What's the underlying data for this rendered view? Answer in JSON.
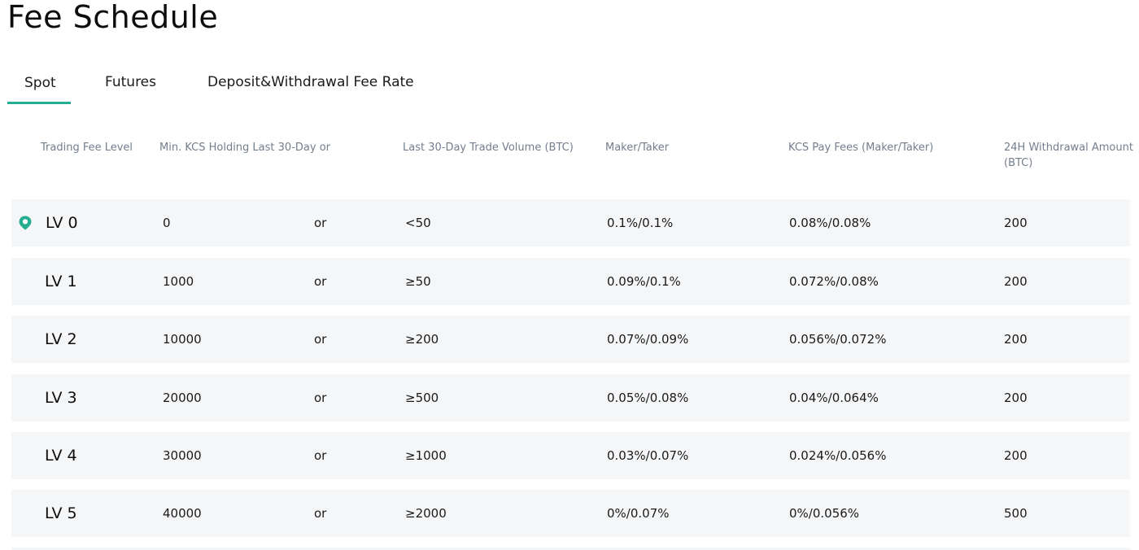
{
  "page": {
    "title": "Fee Schedule"
  },
  "tabs": [
    {
      "label": "Spot",
      "active": true
    },
    {
      "label": "Futures",
      "active": false
    },
    {
      "label": "Deposit&Withdrawal Fee Rate",
      "active": false
    }
  ],
  "table": {
    "headers": {
      "level": "Trading Fee Level",
      "kcs_holding": "Min. KCS Holding Last 30-Day",
      "or": "or",
      "volume": "Last 30-Day Trade Volume (BTC)",
      "maker_taker": "Maker/Taker",
      "kcs_pay": "KCS Pay Fees (Maker/Taker)",
      "withdrawal_line1": "24H Withdrawal Amount",
      "withdrawal_line2": "(BTC)"
    },
    "rows": [
      {
        "level": "LV 0",
        "kcs": "0",
        "or": "or",
        "volume": "<50",
        "maker_taker": "0.1%/0.1%",
        "kcs_pay": "0.08%/0.08%",
        "withdrawal": "200",
        "current": true
      },
      {
        "level": "LV 1",
        "kcs": "1000",
        "or": "or",
        "volume": "≥50",
        "maker_taker": "0.09%/0.1%",
        "kcs_pay": "0.072%/0.08%",
        "withdrawal": "200",
        "current": false
      },
      {
        "level": "LV 2",
        "kcs": "10000",
        "or": "or",
        "volume": "≥200",
        "maker_taker": "0.07%/0.09%",
        "kcs_pay": "0.056%/0.072%",
        "withdrawal": "200",
        "current": false
      },
      {
        "level": "LV 3",
        "kcs": "20000",
        "or": "or",
        "volume": "≥500",
        "maker_taker": "0.05%/0.08%",
        "kcs_pay": "0.04%/0.064%",
        "withdrawal": "200",
        "current": false
      },
      {
        "level": "LV 4",
        "kcs": "30000",
        "or": "or",
        "volume": "≥1000",
        "maker_taker": "0.03%/0.07%",
        "kcs_pay": "0.024%/0.056%",
        "withdrawal": "200",
        "current": false
      },
      {
        "level": "LV 5",
        "kcs": "40000",
        "or": "or",
        "volume": "≥2000",
        "maker_taker": "0%/0.07%",
        "kcs_pay": "0%/0.056%",
        "withdrawal": "500",
        "current": false
      }
    ]
  },
  "icons": {
    "current_level": "location-pin-icon"
  },
  "colors": {
    "accent": "#24ae8f",
    "row_background": "#f5f6f8",
    "header_text": "#737e8d"
  }
}
